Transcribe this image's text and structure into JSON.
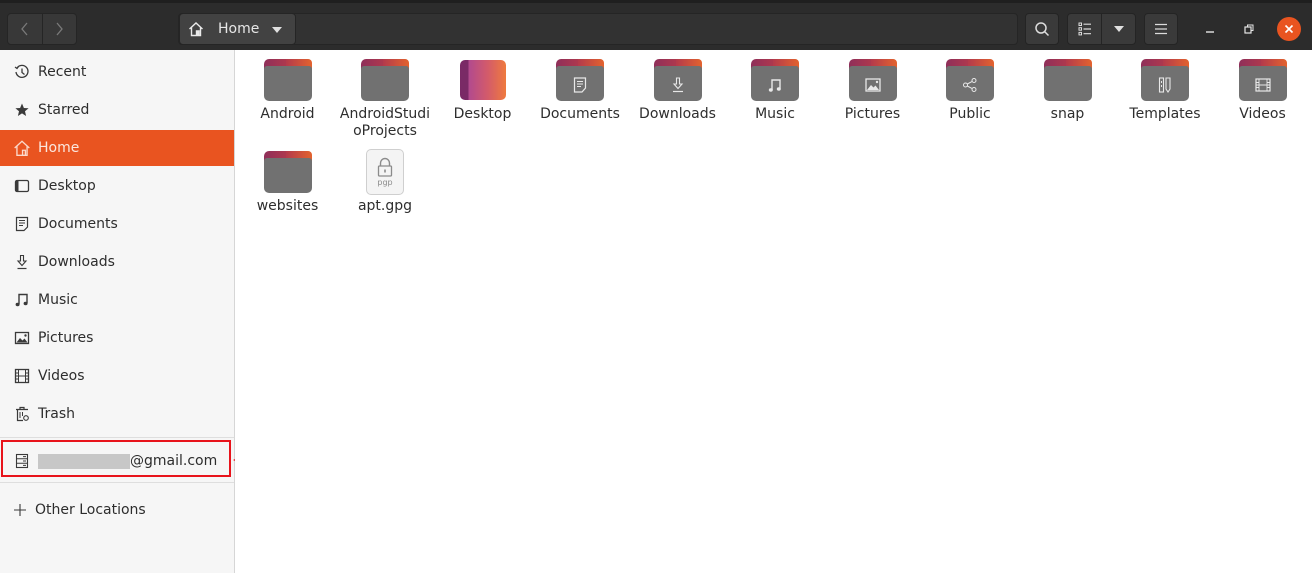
{
  "header": {
    "back_label": "‹",
    "forward_label": "›",
    "path": {
      "icon": "home-icon",
      "label": "Home"
    },
    "buttons": {
      "search": "search-icon",
      "view": "list-view-icon",
      "view_options": "chevron-down-icon",
      "menu": "hamburger-menu-icon"
    },
    "window_controls": [
      "minimize",
      "maximize",
      "close"
    ],
    "close_color": "#e95420"
  },
  "sidebar": {
    "accent_color": "#e95420",
    "items": [
      {
        "label": "Recent",
        "icon": "clock-icon",
        "active": false
      },
      {
        "label": "Starred",
        "icon": "star-icon",
        "active": false
      },
      {
        "label": "Home",
        "icon": "home-icon",
        "active": true
      },
      {
        "label": "Desktop",
        "icon": "desktop-icon",
        "active": false
      },
      {
        "label": "Documents",
        "icon": "document-icon",
        "active": false
      },
      {
        "label": "Downloads",
        "icon": "download-icon",
        "active": false
      },
      {
        "label": "Music",
        "icon": "music-icon",
        "active": false
      },
      {
        "label": "Pictures",
        "icon": "picture-icon",
        "active": false
      },
      {
        "label": "Videos",
        "icon": "video-icon",
        "active": false
      },
      {
        "label": "Trash",
        "icon": "trash-icon",
        "active": false
      }
    ],
    "account": {
      "label_suffix": "@gmail.com",
      "icon": "server-icon",
      "redacted": true
    },
    "other_locations": {
      "label": "Other Locations",
      "icon": "plus-icon"
    }
  },
  "annotation": {
    "color": "#e8131b",
    "type": "highlight-box-with-arrow",
    "target": "account"
  },
  "files": [
    {
      "name": "Android",
      "type": "folder",
      "emblem": ""
    },
    {
      "name": "AndroidStudioProjects",
      "type": "folder",
      "emblem": ""
    },
    {
      "name": "Desktop",
      "type": "desktop",
      "emblem": ""
    },
    {
      "name": "Documents",
      "type": "folder",
      "emblem": "document"
    },
    {
      "name": "Downloads",
      "type": "folder",
      "emblem": "download"
    },
    {
      "name": "Music",
      "type": "folder",
      "emblem": "music"
    },
    {
      "name": "Pictures",
      "type": "folder",
      "emblem": "picture"
    },
    {
      "name": "Public",
      "type": "folder",
      "emblem": "share"
    },
    {
      "name": "snap",
      "type": "folder",
      "emblem": ""
    },
    {
      "name": "Templates",
      "type": "folder",
      "emblem": "template"
    },
    {
      "name": "Videos",
      "type": "folder",
      "emblem": "video"
    },
    {
      "name": "websites",
      "type": "folder",
      "emblem": ""
    },
    {
      "name": "apt.gpg",
      "type": "gpg",
      "emblem": "lock",
      "badge": "pgp"
    }
  ]
}
